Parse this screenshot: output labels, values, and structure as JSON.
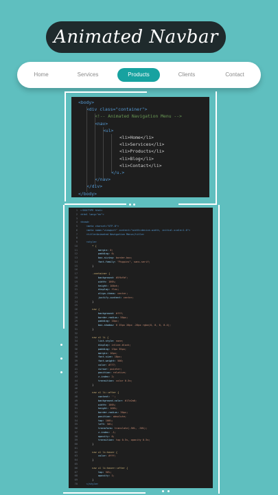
{
  "title": "Animated Navbar",
  "navbar": {
    "items": [
      {
        "label": "Home"
      },
      {
        "label": "Services"
      },
      {
        "label": "Products"
      },
      {
        "label": "Clients"
      },
      {
        "label": "Contact"
      }
    ],
    "active": "Products",
    "accent_color": "#17a2a0"
  },
  "html_snippet": {
    "lines": [
      "<body>",
      "<div class=\"container\">",
      "<!-- Animated Navigation Menu -->",
      "<nav>",
      "<ul>",
      "<li>Home</li>",
      "<li>Services</li>",
      "<li>Products</li>",
      "<li>Blog</li>",
      "<li>Contact</li>",
      "</u.>",
      "</nav>",
      "</div>",
      "</body>"
    ]
  },
  "css_snippet": {
    "lines": [
      "<!DOCTYPE html>",
      "<html lang=\"en\">",
      "",
      "<head>",
      "    <meta charset=\"UTF-8\">",
      "    <meta name=\"viewport\" content=\"width=device-width, initial-scale=1.0\">",
      "    <title>Animated Navigation Menu</title>",
      "",
      "    <style>",
      "        * {",
      "            margin: 0;",
      "            padding: 0;",
      "            box-sizing: border-box;",
      "            font-family: \"Poppins\", sans-serif;",
      "        }",
      "",
      "        .container {",
      "            background: #5fbfbf;",
      "            width: 100%;",
      "            height: 100vh;",
      "            display: flex;",
      "            align-items: center;",
      "            justify-content: center;",
      "        }",
      "",
      "        nav {",
      "            background: #fff;",
      "            border-radius: 50px;",
      "            padding: 10px;",
      "            box-shadow: 0 25px 20px -20px rgba(0, 0, 0, 0.4);",
      "        }",
      "",
      "        nav ul li {",
      "            list-style: none;",
      "            display: inline-block;",
      "            padding: 13px 35px;",
      "            margin: 10px;",
      "            font-size: 18px;",
      "            font-weight: 500;",
      "            color: #777;",
      "            cursor: pointer;",
      "            position: relative;",
      "            z-index: 2;",
      "            transition: color 0.5s;",
      "        }",
      "",
      "        nav ul li::after {",
      "            content: '';",
      "            background-color: #17a2a0;",
      "            width: 100%;",
      "            height: 100%;",
      "            border-radius: 30px;",
      "            position: absolute;",
      "            top: 100%;",
      "            left: 50%;",
      "            transform: translate(-50%, -50%);",
      "            z-index: -1;",
      "            opacity: 0;",
      "            transition: top 0.5s, opacity 0.5s;",
      "        }",
      "",
      "        nav ul li:hover {",
      "            color: #fff;",
      "        }",
      "",
      "        nav ul li:hover::after {",
      "            top: 50%;",
      "            opacity: 1;",
      "        }",
      "    </style>"
    ]
  }
}
